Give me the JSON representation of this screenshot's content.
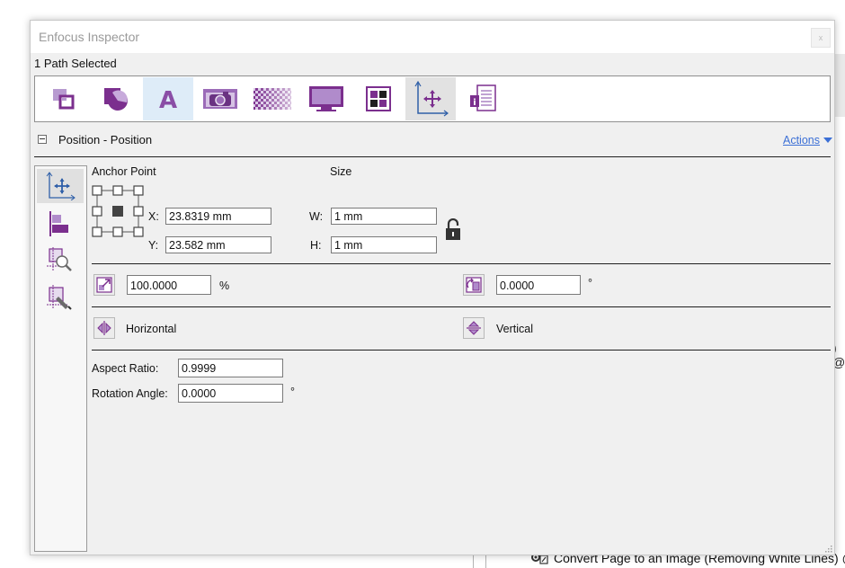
{
  "window": {
    "title": "Enfocus Inspector",
    "close_glyph": "x"
  },
  "selection_label": "1 Path Selected",
  "toolbar": {
    "tabs": [
      {
        "icon": "arrange-icon",
        "state": "normal"
      },
      {
        "icon": "shape-fill-icon",
        "state": "normal"
      },
      {
        "icon": "text-icon",
        "glyph": "A",
        "state": "highlighted"
      },
      {
        "icon": "camera-icon",
        "state": "normal"
      },
      {
        "icon": "transparency-icon",
        "state": "normal"
      },
      {
        "icon": "monitor-icon",
        "state": "normal"
      },
      {
        "icon": "color-swatch-icon",
        "state": "normal"
      },
      {
        "icon": "position-axes-icon",
        "state": "selected"
      },
      {
        "icon": "document-info-icon",
        "state": "normal"
      }
    ]
  },
  "section": {
    "title": "Position - Position",
    "actions_label": "Actions"
  },
  "sidebar": {
    "items": [
      {
        "icon": "position-icon",
        "selected": true
      },
      {
        "icon": "align-icon",
        "selected": false
      },
      {
        "icon": "zoom-object-icon",
        "selected": false
      },
      {
        "icon": "edit-object-icon",
        "selected": false
      }
    ]
  },
  "position": {
    "anchor_label": "Anchor Point",
    "size_label": "Size",
    "x_label": "X:",
    "y_label": "Y:",
    "x_value": "23.8319 mm",
    "y_value": "23.582 mm",
    "w_label": "W:",
    "h_label": "H:",
    "w_value": "1 mm",
    "h_value": "1 mm",
    "lock_icon": "unlocked-padlock-icon"
  },
  "scale": {
    "value": "100.0000",
    "unit": "%"
  },
  "rotate": {
    "value": "0.0000",
    "unit": "°"
  },
  "flip": {
    "horizontal_label": "Horizontal",
    "vertical_label": "Vertical"
  },
  "aspect_ratio": {
    "label": "Aspect Ratio:",
    "value": "0.9999"
  },
  "rotation_angle": {
    "label": "Rotation Angle:",
    "value": "0.0000",
    "unit": "°"
  },
  "background": {
    "right_fragment": ") @",
    "action_item": "Convert Page to an Image (Removing White Lines) @"
  },
  "colors": {
    "accent_purple": "#7b2f8e",
    "link_blue": "#3b6fd6",
    "icon_blue": "#2f5fa8"
  }
}
